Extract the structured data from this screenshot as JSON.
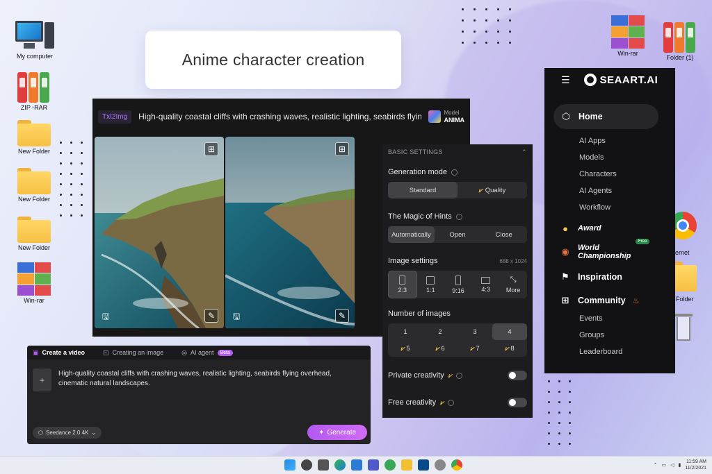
{
  "title_card": "Anime character creation",
  "desktop": {
    "left_icons": [
      "My computer",
      "ZIP -RAR",
      "New Folder",
      "New Folder",
      "New Folder",
      "Win-rar"
    ],
    "right_icons": [
      "Win-rar",
      "Folder (1)",
      "ernet",
      "Folder"
    ]
  },
  "generator": {
    "mode_tag": "Txt2Img",
    "prompt": "High-quality coastal cliffs with crashing waves, realistic lighting, seabirds flyin...",
    "model_label": "Model",
    "model_name": "ANIMA"
  },
  "settings": {
    "header": "BASIC SETTINGS",
    "generation_mode": {
      "label": "Generation mode",
      "options": [
        "Standard",
        "Quality"
      ],
      "selected": "Standard"
    },
    "hints": {
      "label": "The Magic of Hints",
      "options": [
        "Automatically",
        "Open",
        "Close"
      ],
      "selected": "Automatically"
    },
    "image_settings": {
      "label": "Image settings",
      "size": "688 x 1024",
      "ratios": [
        "2:3",
        "1:1",
        "9:16",
        "4:3",
        "More"
      ],
      "selected": "2:3"
    },
    "number_of_images": {
      "label": "Number of images",
      "row1": [
        "1",
        "2",
        "3",
        "4"
      ],
      "row2": [
        "5",
        "6",
        "7",
        "8"
      ],
      "selected": "4"
    },
    "private_creativity": "Private creativity",
    "free_creativity": "Free creativity"
  },
  "video_panel": {
    "tabs": [
      "Create a video",
      "Creating an image",
      "AI agent"
    ],
    "beta": "Beta",
    "prompt": "High-quality coastal cliffs with crashing waves, realistic lighting, seabirds flying overhead, cinematic natural landscapes.",
    "model": "Seedance 2.0 4K",
    "generate": "Generate",
    "add": "+"
  },
  "sidebar": {
    "brand": "SEAART.AI",
    "home": "Home",
    "home_items": [
      "AI Apps",
      "Models",
      "Characters",
      "AI Agents",
      "Workflow"
    ],
    "award": "Award",
    "world_championship": [
      "World",
      "Championship"
    ],
    "free_badge": "Free",
    "inspiration": "Inspiration",
    "community": "Community",
    "community_items": [
      "Events",
      "Groups",
      "Leaderboard"
    ]
  },
  "taskbar": {
    "time": "11:59 AM",
    "date": "11/2/2021"
  },
  "colors": {
    "accent": "#b259f0",
    "sidebar_bg": "#121214",
    "panel_bg": "#1c1c1e",
    "vip_gold": "#f3c84a"
  }
}
